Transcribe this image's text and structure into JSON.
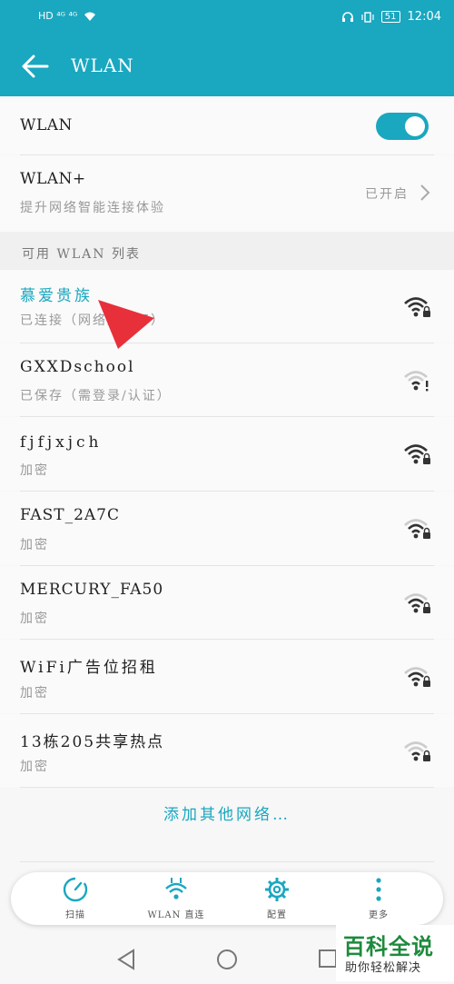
{
  "status_bar": {
    "left_icons": "HD ⁴ᴳ ⁴ᴳ",
    "battery": "51",
    "time": "12:04"
  },
  "app_bar": {
    "title": "WLAN",
    "back_icon": "arrow-left-icon"
  },
  "wlan_toggle": {
    "label": "WLAN",
    "on": true
  },
  "wlan_plus": {
    "title": "WLAN+",
    "subtitle": "提升网络智能连接体验",
    "status": "已开启"
  },
  "section_header": "可用 WLAN 列表",
  "networks": [
    {
      "name": "慕爱贵族",
      "status": "已连接（网络质量好）",
      "connected": true,
      "icon": "wifi-lock-icon"
    },
    {
      "name": "GXXDschool",
      "status": "已保存（需登录/认证）",
      "connected": false,
      "icon": "wifi-alert-icon"
    },
    {
      "name": "fjfjxjch",
      "status": "加密",
      "connected": false,
      "icon": "wifi-lock-icon"
    },
    {
      "name": "FAST_2A7C",
      "status": "加密",
      "connected": false,
      "icon": "wifi-lock-icon"
    },
    {
      "name": "MERCURY_FA50",
      "status": "加密",
      "connected": false,
      "icon": "wifi-lock-icon"
    },
    {
      "name": "WiFi广告位招租",
      "status": "加密",
      "connected": false,
      "icon": "wifi-lock-icon"
    },
    {
      "name": "13栋205共享热点",
      "status": "加密",
      "connected": false,
      "icon": "wifi-lock-icon"
    }
  ],
  "add_network": "添加其他网络…",
  "bottom_bar": [
    {
      "label": "扫描",
      "icon": "scan-icon"
    },
    {
      "label": "WLAN 直连",
      "icon": "wlan-direct-icon"
    },
    {
      "label": "配置",
      "icon": "gear-icon"
    },
    {
      "label": "更多",
      "icon": "more-icon"
    }
  ],
  "nav_bar": [
    "back-triangle-icon",
    "home-circle-icon",
    "recents-square-icon"
  ],
  "watermark": {
    "title": "百科全说",
    "subtitle": "助你轻松解决"
  },
  "colors": {
    "accent": "#1aa7c0",
    "watermark_green": "#1e8a3d",
    "annotation_red": "#e8303a"
  }
}
